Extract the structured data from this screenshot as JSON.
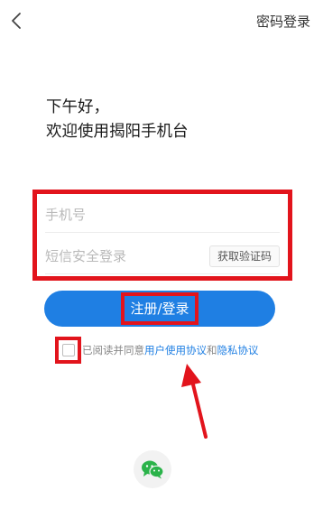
{
  "header": {
    "back_icon": "chevron-left-icon",
    "password_login_label": "密码登录"
  },
  "greeting": {
    "line1": "下午好，",
    "line2": "欢迎使用揭阳手机台"
  },
  "form": {
    "phone_placeholder": "手机号",
    "sms_placeholder": "短信安全登录",
    "get_code_label": "获取验证码"
  },
  "submit": {
    "label": "注册/登录"
  },
  "agreement": {
    "prefix": "已阅读并同意",
    "user_agreement": "用户使用协议",
    "and": "和",
    "privacy_agreement": "隐私协议",
    "checked": false
  },
  "social": {
    "wechat_icon": "wechat-icon"
  },
  "colors": {
    "accent": "#1f7fe3",
    "highlight": "#e2141c",
    "placeholder": "#b9b9b9"
  }
}
